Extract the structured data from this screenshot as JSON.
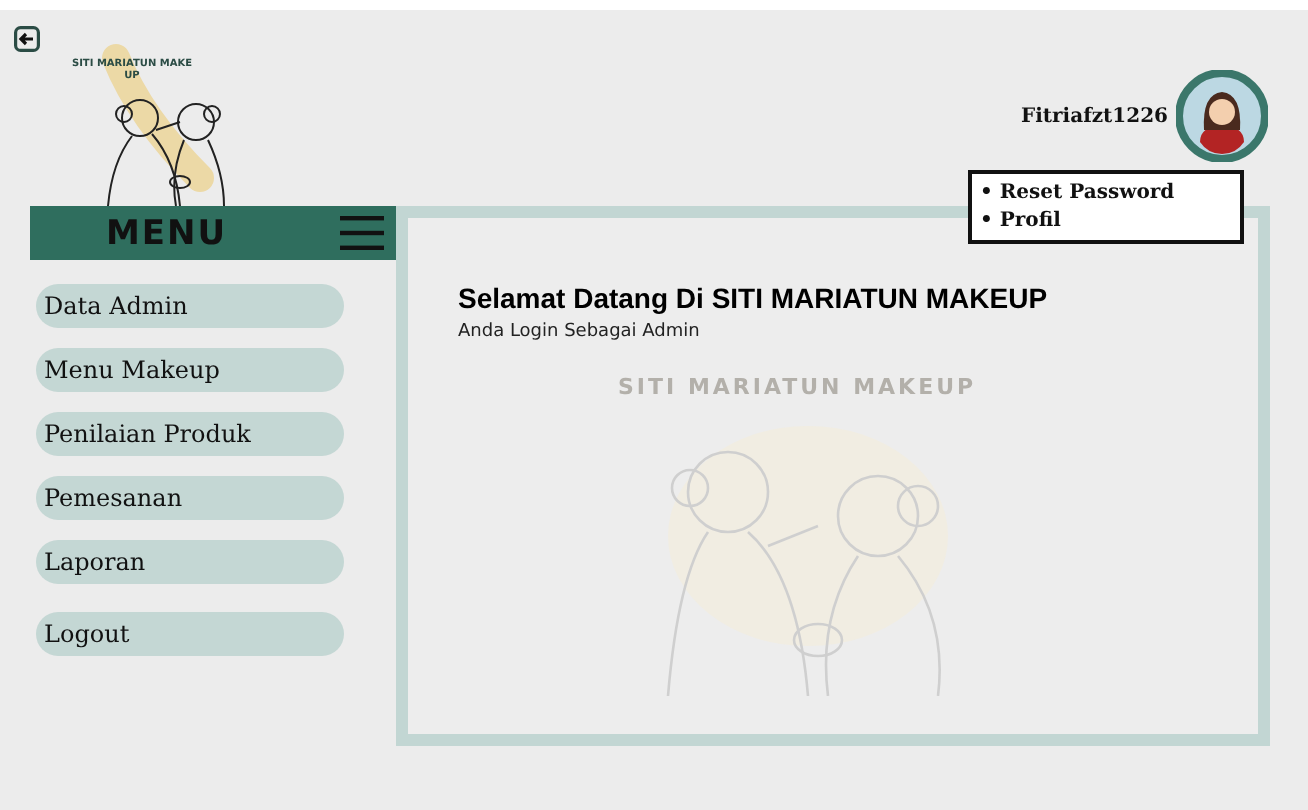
{
  "logo": {
    "text": "SITI MARIATUN MAKE UP"
  },
  "menu": {
    "title": "MENU",
    "items": [
      {
        "label": "Data Admin"
      },
      {
        "label": "Menu Makeup"
      },
      {
        "label": "Penilaian Produk"
      },
      {
        "label": "Pemesanan"
      },
      {
        "label": "Laporan"
      },
      {
        "label": "Logout"
      }
    ]
  },
  "user": {
    "name": "Fitriafzt1226",
    "dropdown": [
      {
        "label": "• Reset Password"
      },
      {
        "label": "• Profil"
      }
    ]
  },
  "main": {
    "heading": "Selamat Datang Di SITI MARIATUN MAKEUP",
    "subheading": "Anda Login Sebagai Admin",
    "background_text": "SITI MARIATUN MAKEUP"
  }
}
